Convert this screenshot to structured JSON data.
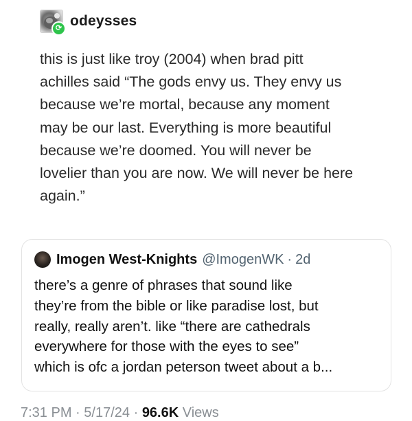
{
  "tumblr_post": {
    "username": "odeysses",
    "text": "this is just like troy (2004) when brad pitt\nachilles said “The gods envy us. They envy us\nbecause we’re mortal, because any moment\nmay be our last. Everything is more beautiful\nbecause we’re doomed. You will never be\nlovelier than you are now. We will never be here\nagain.”"
  },
  "quote_tweet": {
    "display_name": "Imogen West-Knights",
    "handle": "@ImogenWK",
    "separator": "·",
    "time": "2d",
    "text": "there’s a genre of phrases that sound like\nthey’re from the bible or like paradise lost, but\nreally, really aren’t. like “there are cathedrals\neverywhere for those with the eyes to see”\nwhich is ofc a jordan peterson tweet about a b..."
  },
  "footer": {
    "time": "7:31 PM",
    "date": "5/17/24",
    "views_count": "96.6K",
    "views_label": "Views"
  },
  "icons": {
    "reblog_badge": "reblog-icon",
    "badge_color": "#2ec44b"
  }
}
